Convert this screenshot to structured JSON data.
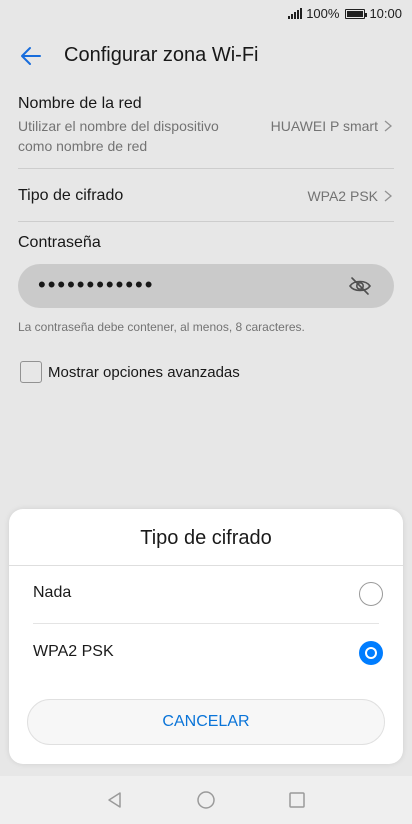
{
  "status_bar": {
    "battery_percent": "100%",
    "time": "10:00"
  },
  "header": {
    "title": "Configurar zona Wi-Fi"
  },
  "settings": {
    "network_name": {
      "title": "Nombre de la red",
      "subtitle_line1": "Utilizar el nombre del dispositivo",
      "subtitle_line2": "como nombre de red",
      "value": "HUAWEI P smart"
    },
    "encryption": {
      "title": "Tipo de cifrado",
      "value": "WPA2 PSK"
    },
    "password": {
      "title": "Contraseña",
      "masked_value": "••••••••••••",
      "hint": "La contraseña debe contener, al menos, 8 caracteres."
    },
    "advanced": {
      "label": "Mostrar opciones avanzadas",
      "checked": false
    }
  },
  "dialog": {
    "title": "Tipo de cifrado",
    "options": [
      {
        "label": "Nada",
        "selected": false
      },
      {
        "label": "WPA2 PSK",
        "selected": true
      }
    ],
    "cancel_label": "CANCELAR"
  },
  "colors": {
    "accent": "#007dff",
    "cancel_text": "#0a74d8"
  },
  "icons": [
    "back-arrow-icon",
    "chevron-right-icon",
    "eye-off-icon",
    "signal-icon",
    "battery-icon",
    "nav-back-icon",
    "nav-home-icon",
    "nav-recents-icon"
  ]
}
